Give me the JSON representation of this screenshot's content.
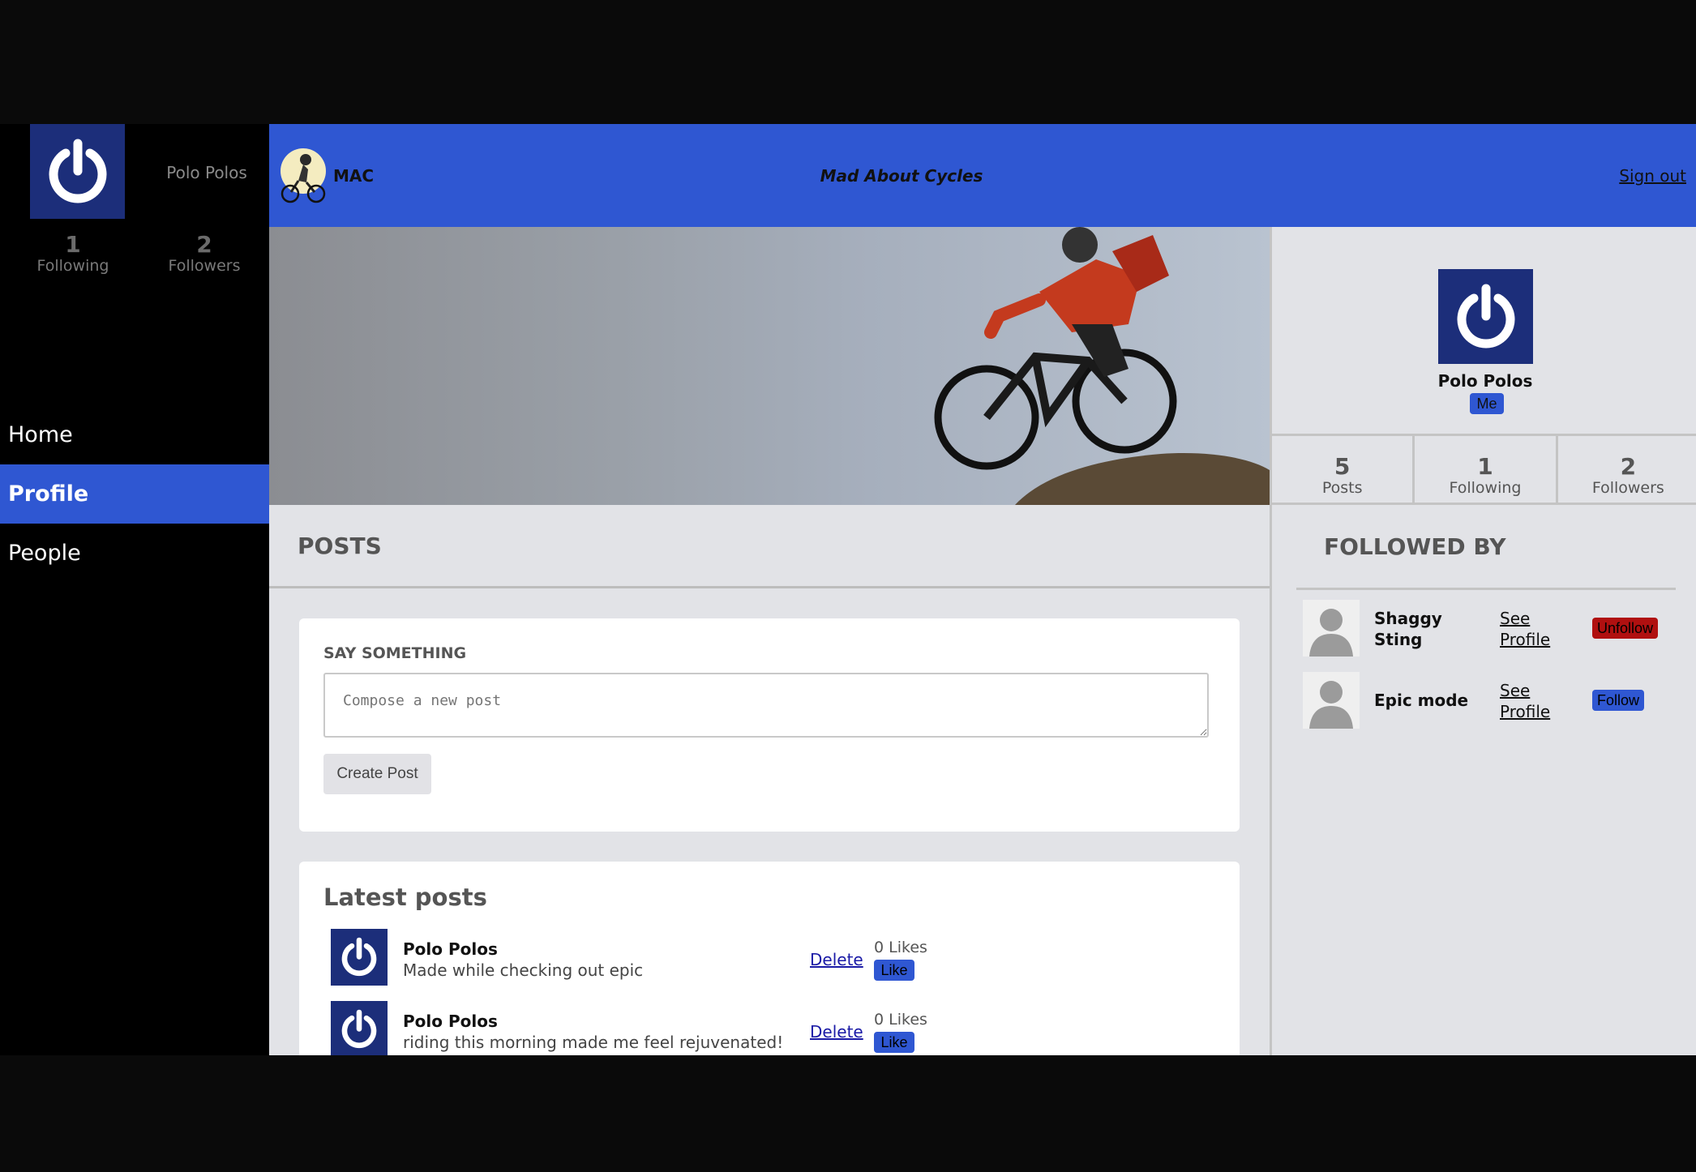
{
  "sidebar": {
    "username": "Polo Polos",
    "following_count": "1",
    "following_label": "Following",
    "followers_count": "2",
    "followers_label": "Followers",
    "nav": [
      {
        "label": "Home",
        "active": false
      },
      {
        "label": "Profile",
        "active": true
      },
      {
        "label": "People",
        "active": false
      }
    ]
  },
  "topbar": {
    "brand_short": "MAC",
    "brand_full": "Mad About Cycles",
    "signout_label": "Sign out",
    "color": "#2f57d2"
  },
  "main": {
    "posts_heading": "POSTS",
    "compose": {
      "title": "SAY SOMETHING",
      "placeholder": "Compose a new post",
      "button_label": "Create Post"
    },
    "latest_heading": "Latest posts",
    "posts": [
      {
        "author": "Polo Polos",
        "text": "Made while checking out epic",
        "delete_label": "Delete",
        "likes": "0 Likes",
        "like_label": "Like"
      },
      {
        "author": "Polo Polos",
        "text": "riding this morning made me feel rejuvenated!",
        "delete_label": "Delete",
        "likes": "0 Likes",
        "like_label": "Like"
      }
    ]
  },
  "profile": {
    "name": "Polo Polos",
    "badge": "Me",
    "stats": [
      {
        "num": "5",
        "label": "Posts"
      },
      {
        "num": "1",
        "label": "Following"
      },
      {
        "num": "2",
        "label": "Followers"
      }
    ],
    "followed_heading": "FOLLOWED BY",
    "followers": [
      {
        "name": "Shaggy Sting",
        "link_label": "See Profile",
        "button_label": "Unfollow",
        "button_color": "#b01010"
      },
      {
        "name": "Epic mode",
        "link_label": "See Profile",
        "button_label": "Follow",
        "button_color": "#2f57d2"
      }
    ]
  },
  "icons": {
    "avatar": "power-icon",
    "logo": "cyclist-logo-icon",
    "follower_avatar": "default-user-icon"
  }
}
